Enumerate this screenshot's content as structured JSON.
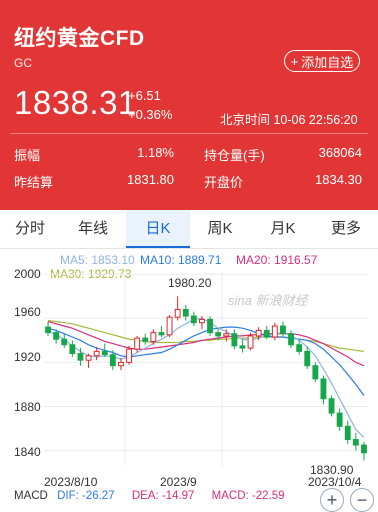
{
  "header": {
    "title": "纽约黄金CFD",
    "code": "GC",
    "watch_label": "添加自选",
    "price": "1838.31",
    "change_abs": "+6.51",
    "change_pct": "+0.36%",
    "time_label": "北京时间 10-06 22:56:20",
    "stats": {
      "amplitude_label": "振幅",
      "amplitude": "1.18%",
      "open_interest_label": "持仓量(手)",
      "open_interest": "368064",
      "prev_settle_label": "昨结算",
      "prev_settle": "1831.80",
      "open_label": "开盘价",
      "open": "1834.30"
    }
  },
  "tabs": [
    "分时",
    "年线",
    "日K",
    "周K",
    "月K",
    "更多"
  ],
  "active_tab": "日K",
  "ma": {
    "ma5": "MA5: 1853.10",
    "ma10": "MA10: 1889.71",
    "ma20": "MA20: 1916.57",
    "ma30": "MA30: 1929.73"
  },
  "watermark": "sina 新浪财经",
  "colors": {
    "up": "#e0262b",
    "down": "#16a74a",
    "accent": "#1769d9",
    "header_bg": "#e23636",
    "ma5": "#8fb3e6",
    "ma10": "#2c7be5",
    "ma20": "#d62e7c",
    "ma30": "#a8b83a"
  },
  "chart_data": {
    "type": "candlestick",
    "y_ticks": [
      "2000",
      "1960",
      "1920",
      "1880",
      "1840"
    ],
    "ylim": [
      1826,
      2002
    ],
    "x_labels": [
      "2023/8/10",
      "2023/9",
      "2023/10/4"
    ],
    "high_label": "1980.20",
    "low_label": "1830.90",
    "candles": [
      [
        1952,
        1957,
        1944,
        1947
      ],
      [
        1947,
        1950,
        1937,
        1941
      ],
      [
        1941,
        1946,
        1933,
        1936
      ],
      [
        1936,
        1940,
        1925,
        1928
      ],
      [
        1928,
        1933,
        1917,
        1922
      ],
      [
        1922,
        1928,
        1915,
        1926
      ],
      [
        1926,
        1934,
        1922,
        1930
      ],
      [
        1930,
        1937,
        1925,
        1927
      ],
      [
        1927,
        1931,
        1913,
        1917
      ],
      [
        1917,
        1924,
        1913,
        1920
      ],
      [
        1920,
        1935,
        1918,
        1932
      ],
      [
        1932,
        1944,
        1929,
        1942
      ],
      [
        1942,
        1946,
        1936,
        1939
      ],
      [
        1939,
        1950,
        1936,
        1947
      ],
      [
        1947,
        1953,
        1943,
        1945
      ],
      [
        1945,
        1963,
        1943,
        1961
      ],
      [
        1961,
        1980,
        1958,
        1968
      ],
      [
        1968,
        1972,
        1958,
        1962
      ],
      [
        1962,
        1966,
        1953,
        1956
      ],
      [
        1956,
        1962,
        1950,
        1959
      ],
      [
        1959,
        1962,
        1944,
        1947
      ],
      [
        1947,
        1951,
        1940,
        1944
      ],
      [
        1944,
        1950,
        1939,
        1946
      ],
      [
        1946,
        1950,
        1932,
        1935
      ],
      [
        1935,
        1941,
        1929,
        1933
      ],
      [
        1933,
        1947,
        1931,
        1944
      ],
      [
        1944,
        1952,
        1940,
        1949
      ],
      [
        1949,
        1953,
        1941,
        1943
      ],
      [
        1943,
        1956,
        1940,
        1953
      ],
      [
        1953,
        1957,
        1944,
        1946
      ],
      [
        1946,
        1949,
        1933,
        1936
      ],
      [
        1936,
        1940,
        1927,
        1930
      ],
      [
        1930,
        1934,
        1914,
        1917
      ],
      [
        1917,
        1920,
        1902,
        1905
      ],
      [
        1905,
        1908,
        1882,
        1887
      ],
      [
        1887,
        1890,
        1871,
        1874
      ],
      [
        1874,
        1878,
        1858,
        1862
      ],
      [
        1862,
        1867,
        1846,
        1850
      ],
      [
        1850,
        1856,
        1840,
        1845
      ],
      [
        1845,
        1848,
        1831,
        1838
      ]
    ],
    "ma_lines": {
      "ma5": [
        1948,
        1945,
        1941,
        1935,
        1930,
        1926,
        1925,
        1926,
        1925,
        1923,
        1925,
        1929,
        1933,
        1937,
        1941,
        1945,
        1951,
        1955,
        1959,
        1960,
        1956,
        1951,
        1948,
        1944,
        1941,
        1940,
        1942,
        1944,
        1946,
        1947,
        1944,
        1940,
        1934,
        1926,
        1914,
        1901,
        1887,
        1873,
        1859,
        1852
      ],
      "ma10": [
        1951,
        1949,
        1946,
        1943,
        1940,
        1936,
        1933,
        1931,
        1929,
        1926,
        1925,
        1926,
        1927,
        1928,
        1929,
        1932,
        1936,
        1940,
        1944,
        1947,
        1950,
        1951,
        1952,
        1952,
        1951,
        1949,
        1946,
        1944,
        1943,
        1943,
        1942,
        1941,
        1940,
        1937,
        1932,
        1925,
        1918,
        1909,
        1900,
        1890
      ],
      "ma20": [
        1957,
        1955,
        1953,
        1951,
        1948,
        1945,
        1942,
        1939,
        1937,
        1935,
        1933,
        1932,
        1932,
        1933,
        1934,
        1935,
        1936,
        1937,
        1938,
        1940,
        1941,
        1942,
        1943,
        1944,
        1944,
        1945,
        1945,
        1946,
        1946,
        1946,
        1946,
        1945,
        1943,
        1940,
        1937,
        1933,
        1929,
        1925,
        1920,
        1917
      ],
      "ma30": [
        1958,
        1957,
        1956,
        1955,
        1953,
        1951,
        1949,
        1947,
        1945,
        1943,
        1941,
        1940,
        1939,
        1938,
        1938,
        1938,
        1938,
        1939,
        1939,
        1940,
        1940,
        1941,
        1941,
        1942,
        1942,
        1942,
        1943,
        1943,
        1943,
        1943,
        1942,
        1941,
        1940,
        1939,
        1937,
        1935,
        1933,
        1932,
        1931,
        1930
      ]
    }
  },
  "macd": {
    "label": "MACD",
    "dif": "DIF: -26.27",
    "dea": "DEA: -14.97",
    "macd": "MACD: -22.59"
  }
}
